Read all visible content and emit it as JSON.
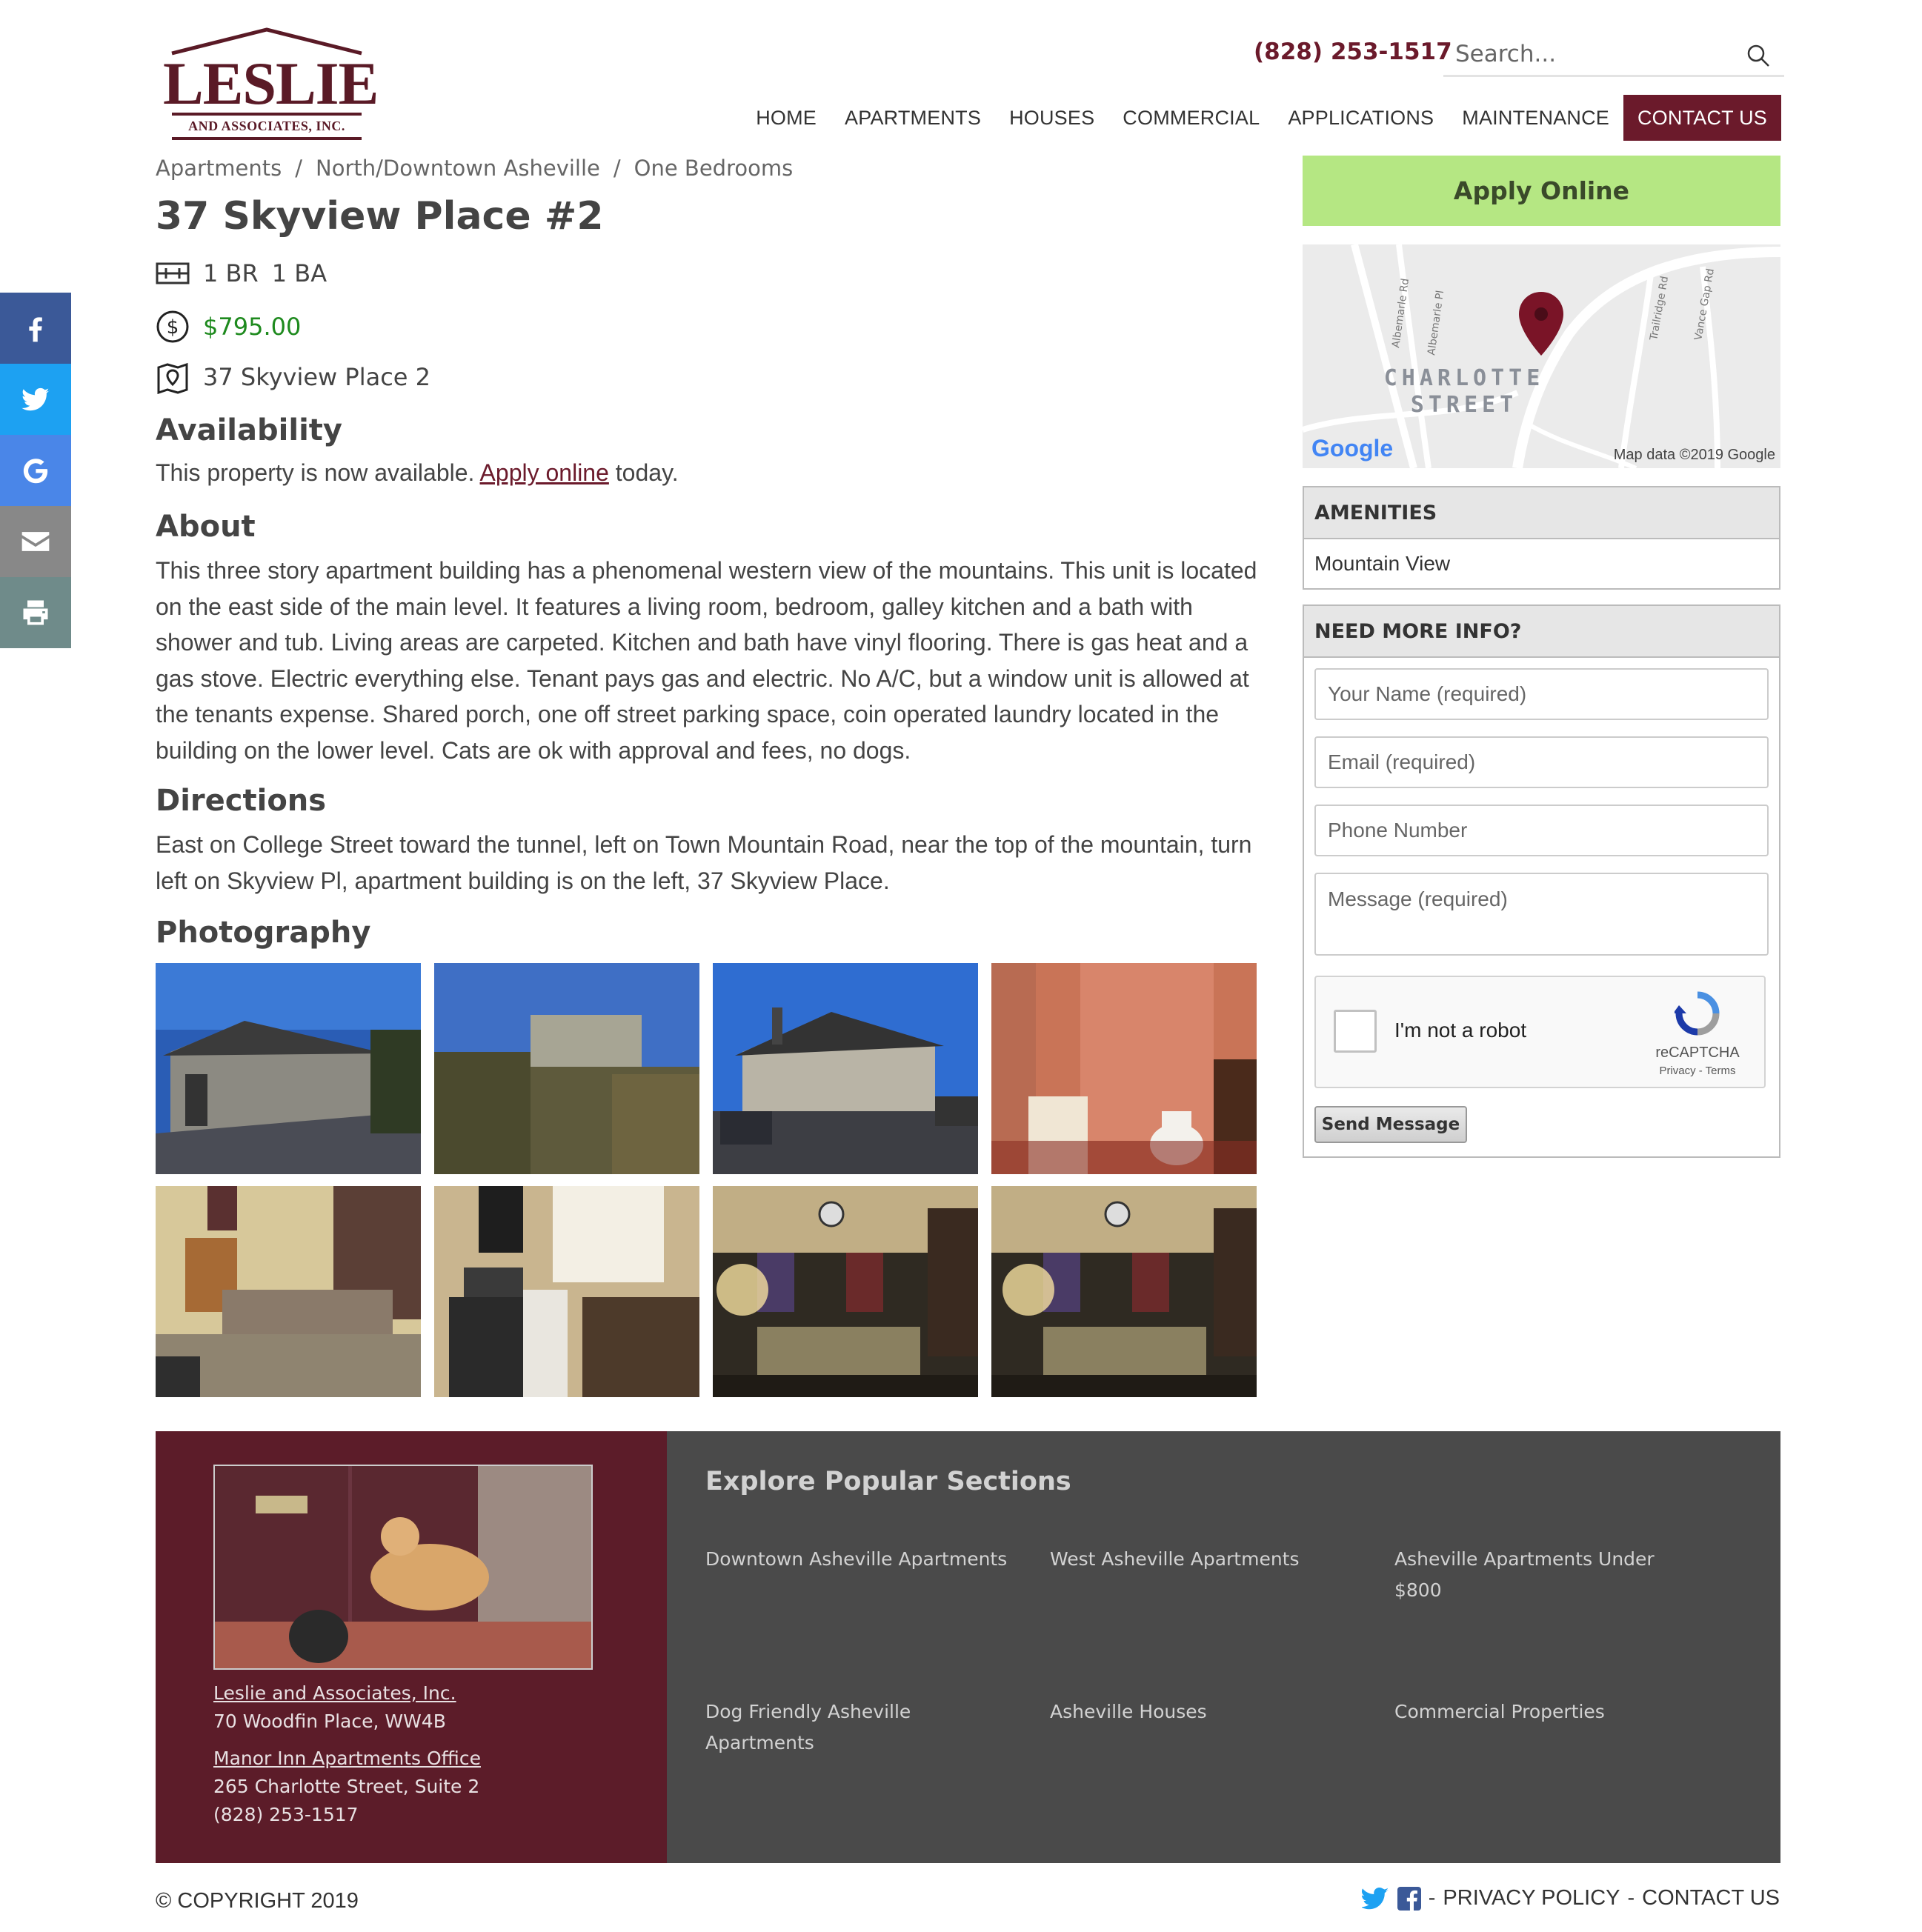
{
  "header": {
    "logo_name": "LESLIE",
    "logo_sub": "AND ASSOCIATES, INC.",
    "phone": "(828) 253-1517",
    "search_placeholder": "Search..."
  },
  "nav": [
    {
      "label": "HOME"
    },
    {
      "label": "APARTMENTS"
    },
    {
      "label": "HOUSES"
    },
    {
      "label": "COMMERCIAL"
    },
    {
      "label": "APPLICATIONS"
    },
    {
      "label": "MAINTENANCE"
    },
    {
      "label": "CONTACT US"
    }
  ],
  "social": [
    {
      "icon": "facebook-icon",
      "color": "#3b5998"
    },
    {
      "icon": "twitter-icon",
      "color": "#1da1f2"
    },
    {
      "icon": "google-icon",
      "color": "#4a86e8"
    },
    {
      "icon": "email-icon",
      "color": "#888888"
    },
    {
      "icon": "print-icon",
      "color": "#6f8b8a"
    }
  ],
  "breadcrumb": [
    "Apartments",
    "North/Downtown Asheville",
    "One Bedrooms"
  ],
  "listing": {
    "title": "37 Skyview Place #2",
    "beds": "1 BR",
    "baths": "1 BA",
    "price": "$795.00",
    "address": "37 Skyview Place 2"
  },
  "availability": {
    "heading": "Availability",
    "text_before": "This property is now available. ",
    "link": "Apply online",
    "text_after": " today."
  },
  "about": {
    "heading": "About",
    "text": "This three story apartment building has a phenomenal western view of the mountains. This unit is located on the east side of the main level. It features a living room, bedroom, galley kitchen and a bath with shower and tub. Living areas are carpeted. Kitchen and bath have vinyl flooring. There is gas heat and a gas stove. Electric everything else. Tenant pays gas and electric. No A/C, but a window unit is allowed at the tenants expense. Shared porch, one off street parking space, coin operated laundry located in the building on the lower level. Cats are ok with approval and fees, no dogs."
  },
  "directions": {
    "heading": "Directions",
    "text": "East on College Street toward the tunnel, left on Town Mountain Road, near the top of the mountain, turn left on Skyview Pl, apartment building is on the left, 37 Skyview Place."
  },
  "photography": {
    "heading": "Photography"
  },
  "sidebar": {
    "apply_label": "Apply Online",
    "map": {
      "streets": [
        "Albemarle Rd",
        "Albemarle Pl",
        "Trailridge Rd",
        "Vance Gap Rd"
      ],
      "area_line1": "CHARLOTTE",
      "area_line2": "STREET",
      "google": "Google",
      "credit": "Map data ©2019 Google"
    },
    "amenities_title": "AMENITIES",
    "amenities": [
      "Mountain View"
    ],
    "info_title": "NEED MORE INFO?",
    "form": {
      "name_placeholder": "Your Name (required)",
      "email_placeholder": "Email (required)",
      "phone_placeholder": "Phone Number",
      "message_placeholder": "Message (required)",
      "captcha_label": "I'm not a robot",
      "captcha_brand": "reCAPTCHA",
      "captcha_links": "Privacy - Terms",
      "send_label": "Send Message"
    }
  },
  "footer": {
    "company_link": "Leslie and Associates, Inc.",
    "company_addr": "70 Woodfin Place, WW4B",
    "office_link": "Manor Inn Apartments Office",
    "office_addr": "265 Charlotte Street, Suite 2",
    "office_phone": "(828) 253-1517",
    "explore_title": "Explore Popular Sections",
    "links": [
      "Downtown Asheville Apartments",
      "West Asheville Apartments",
      "Asheville Apartments Under $800",
      "Dog Friendly Asheville Apartments",
      "Asheville Houses",
      "Commercial Properties"
    ],
    "copyright": "© COPYRIGHT 2019",
    "privacy": "PRIVACY POLICY",
    "contact": "CONTACT US",
    "dash": "-"
  },
  "colors": {
    "brand": "#6b1a2b",
    "apply_green": "#b5e783",
    "price_green": "#1e8a1e",
    "footer_dark": "#4a4a4a",
    "footer_brand": "#5c1c29"
  }
}
